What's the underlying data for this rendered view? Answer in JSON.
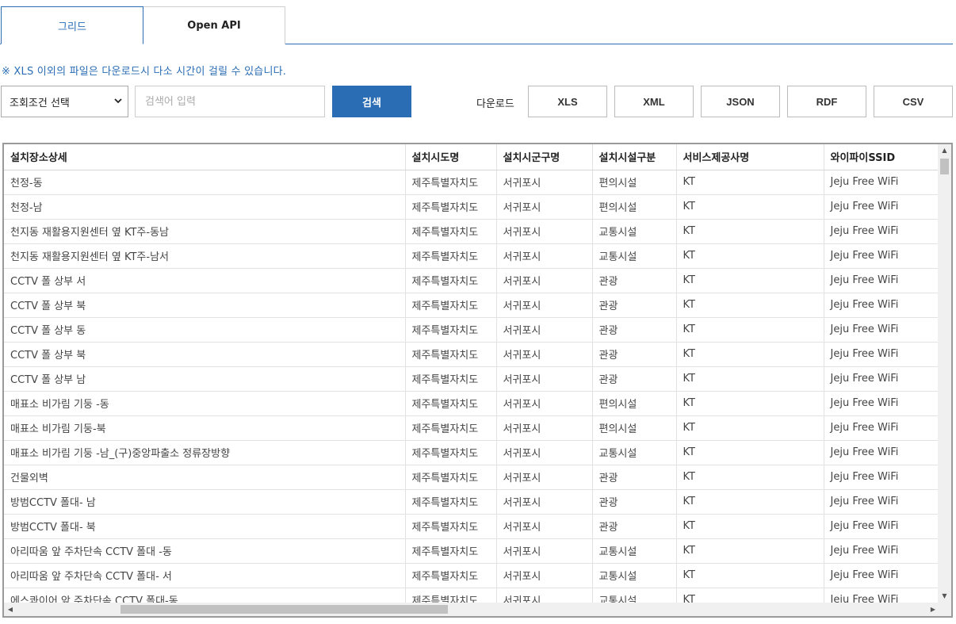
{
  "tabs": [
    {
      "label": "그리드",
      "active": true
    },
    {
      "label": "Open API",
      "active": false
    }
  ],
  "notice": "※ XLS 이외의 파일은 다운로드시 다소 시간이 걸릴 수 있습니다.",
  "search": {
    "condition_selected": "조회조건 선택",
    "placeholder": "검색어 입력",
    "button_label": "검색"
  },
  "download": {
    "label": "다운로드",
    "formats": [
      "XLS",
      "XML",
      "JSON",
      "RDF",
      "CSV"
    ]
  },
  "colors": {
    "accent": "#2a6db5"
  },
  "grid": {
    "columns": [
      "설치장소상세",
      "설치시도명",
      "설치시군구명",
      "설치시설구분",
      "서비스제공사명",
      "와이파이SSID"
    ],
    "rows": [
      [
        "천정-동",
        "제주특별자치도",
        "서귀포시",
        "편의시설",
        "KT",
        "Jeju Free WiFi"
      ],
      [
        "천정-남",
        "제주특별자치도",
        "서귀포시",
        "편의시설",
        "KT",
        "Jeju Free WiFi"
      ],
      [
        "천지동 재활용지원센터 옆 KT주-동남",
        "제주특별자치도",
        "서귀포시",
        "교통시설",
        "KT",
        "Jeju Free WiFi"
      ],
      [
        "천지동 재활용지원센터 옆 KT주-남서",
        "제주특별자치도",
        "서귀포시",
        "교통시설",
        "KT",
        "Jeju Free WiFi"
      ],
      [
        "CCTV 폴 상부 서",
        "제주특별자치도",
        "서귀포시",
        "관광",
        "KT",
        "Jeju Free WiFi"
      ],
      [
        "CCTV 폴 상부 북",
        "제주특별자치도",
        "서귀포시",
        "관광",
        "KT",
        "Jeju Free WiFi"
      ],
      [
        "CCTV 폴 상부 동",
        "제주특별자치도",
        "서귀포시",
        "관광",
        "KT",
        "Jeju Free WiFi"
      ],
      [
        "CCTV 폴 상부 북",
        "제주특별자치도",
        "서귀포시",
        "관광",
        "KT",
        "Jeju Free WiFi"
      ],
      [
        "CCTV 폴 상부 남",
        "제주특별자치도",
        "서귀포시",
        "관광",
        "KT",
        "Jeju Free WiFi"
      ],
      [
        "매표소 비가림 기둥 -동",
        "제주특별자치도",
        "서귀포시",
        "편의시설",
        "KT",
        "Jeju Free WiFi"
      ],
      [
        "매표소 비가림 기둥-북",
        "제주특별자치도",
        "서귀포시",
        "편의시설",
        "KT",
        "Jeju Free WiFi"
      ],
      [
        "매표소 비가림 기둥 -남_(구)중앙파출소 정류장방향",
        "제주특별자치도",
        "서귀포시",
        "교통시설",
        "KT",
        "Jeju Free WiFi"
      ],
      [
        "건물외벽",
        "제주특별자치도",
        "서귀포시",
        "관광",
        "KT",
        "Jeju Free WiFi"
      ],
      [
        "방범CCTV 폴대- 남",
        "제주특별자치도",
        "서귀포시",
        "관광",
        "KT",
        "Jeju Free WiFi"
      ],
      [
        "방범CCTV 폴대- 북",
        "제주특별자치도",
        "서귀포시",
        "관광",
        "KT",
        "Jeju Free WiFi"
      ],
      [
        "아리따움 앞 주차단속 CCTV 폴대 -동",
        "제주특별자치도",
        "서귀포시",
        "교통시설",
        "KT",
        "Jeju Free WiFi"
      ],
      [
        "아리따움 앞 주차단속 CCTV 폴대- 서",
        "제주특별자치도",
        "서귀포시",
        "교통시설",
        "KT",
        "Jeju Free WiFi"
      ],
      [
        "에스콰이어 앞 주차단속 CCTV 폴대-동",
        "제주특별자치도",
        "서귀포시",
        "교통시설",
        "KT",
        "Jeju Free WiFi"
      ]
    ]
  }
}
